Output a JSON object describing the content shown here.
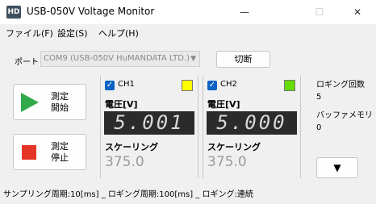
{
  "window": {
    "icon_text": "HD",
    "title": "USB-050V Voltage Monitor",
    "minimize": "—",
    "maximize": "☐",
    "close": "✕"
  },
  "menu": {
    "file": "ファイル(F)",
    "settings": "設定(S)",
    "help": "ヘルプ(H)"
  },
  "port": {
    "label": "ポート",
    "selected": "COM9 (USB-050V HuMANDATA LTD.)",
    "disconnect_label": "切断"
  },
  "controls": {
    "start_label_1": "測定",
    "start_label_2": "開始",
    "stop_label_1": "測定",
    "stop_label_2": "停止"
  },
  "channels": [
    {
      "name": "CH1",
      "checked": true,
      "color": "#ffff00",
      "voltage_label": "電圧[V]",
      "voltage": "5.001",
      "scaling_label": "スケーリング",
      "scaling": "375.0"
    },
    {
      "name": "CH2",
      "checked": true,
      "color": "#66dd00",
      "voltage_label": "電圧[V]",
      "voltage": "5.000",
      "scaling_label": "スケーリング",
      "scaling": "375.0"
    }
  ],
  "info": {
    "logging_count_label": "ロギング回数",
    "logging_count": "5",
    "buffer_memory_label": "バッファメモリ",
    "buffer_memory": "0",
    "expand_button": "▼"
  },
  "status": {
    "text": "サンプリング周期:10[ms] _ ロギング周期:100[ms] _ ロギング:連続"
  }
}
